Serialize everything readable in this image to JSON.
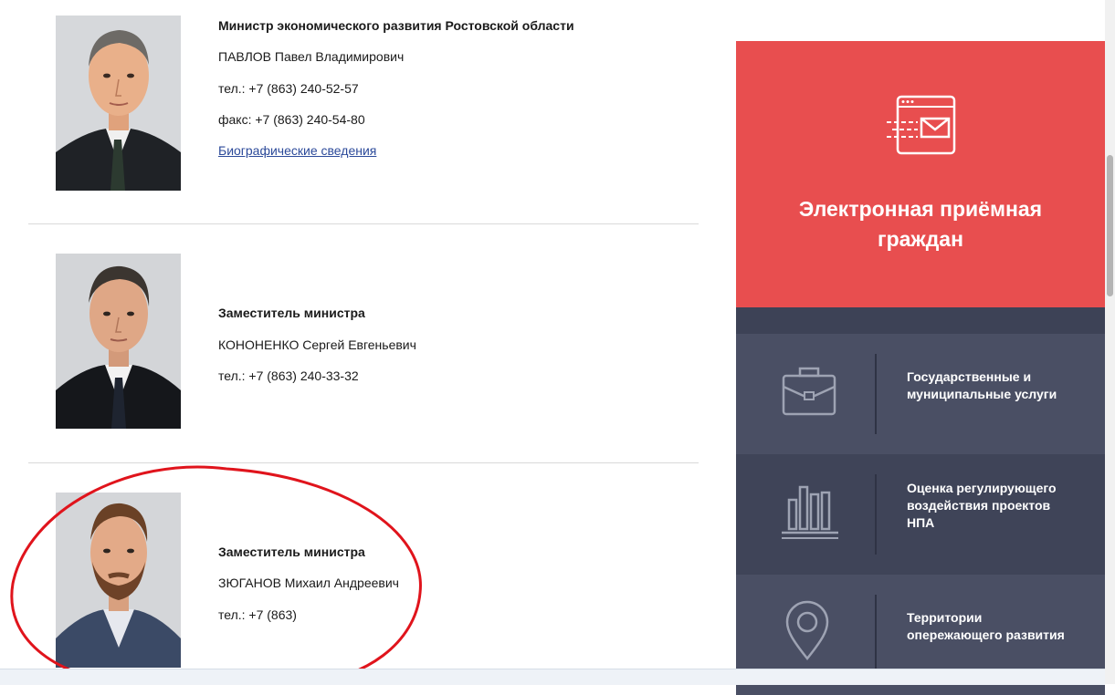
{
  "people": [
    {
      "role": "Министр экономического развития Ростовской области",
      "name": "ПАВЛОВ Павел Владимирович",
      "phone": "тел.: +7 (863) 240-52-57",
      "fax": "факс: +7 (863) 240-54-80",
      "bio_link": "Биографические сведения"
    },
    {
      "role": "Заместитель министра",
      "name": "КОНОНЕНКО Сергей Евгеньевич",
      "phone": "тел.: +7 (863) 240-33-32"
    },
    {
      "role": "Заместитель министра",
      "name": "ЗЮГАНОВ Михаил Андреевич",
      "phone": "тел.: +7 (863)"
    }
  ],
  "sidebar": {
    "reception": {
      "title": "Электронная приёмная граждан",
      "icon": "email-window-icon"
    },
    "services": [
      {
        "label": "Государственные и муниципальные услуги",
        "icon": "briefcase-icon"
      },
      {
        "label": "Оценка регулирующего воздействия проектов НПА",
        "icon": "bar-chart-icon"
      },
      {
        "label": "Территории опережающего развития",
        "icon": "map-pin-icon"
      }
    ]
  },
  "colors": {
    "reception_bg": "#e84e4f",
    "service_bg_a": "#4a4f64",
    "service_bg_b": "#3f4458",
    "link": "#2c4a9a",
    "annotation": "#e0141c"
  }
}
